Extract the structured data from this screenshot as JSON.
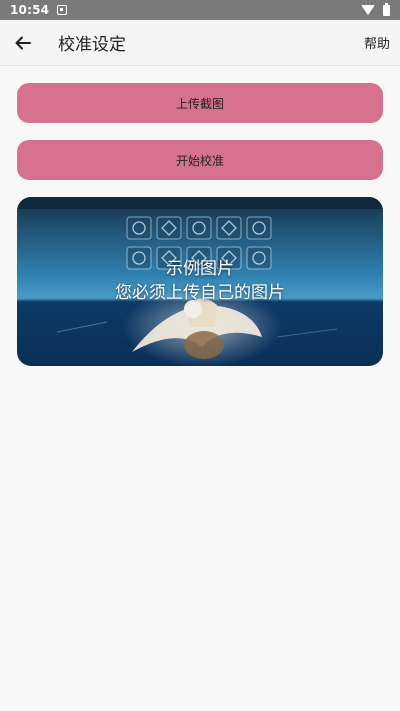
{
  "status_bar": {
    "time": "10:54",
    "icons": [
      "notification-icon",
      "wifi-icon",
      "battery-icon"
    ]
  },
  "app_bar": {
    "title": "校准设定",
    "help_label": "帮助",
    "back_icon": "back-arrow-icon"
  },
  "buttons": {
    "upload_label": "上传截图",
    "start_label": "开始校准"
  },
  "sample_image": {
    "line1": "示例图片",
    "line2": "您必须上传自己的图片"
  },
  "colors": {
    "accent": "#d6728f",
    "status_bar": "#7a7a7a",
    "background": "#f8f8f8"
  }
}
